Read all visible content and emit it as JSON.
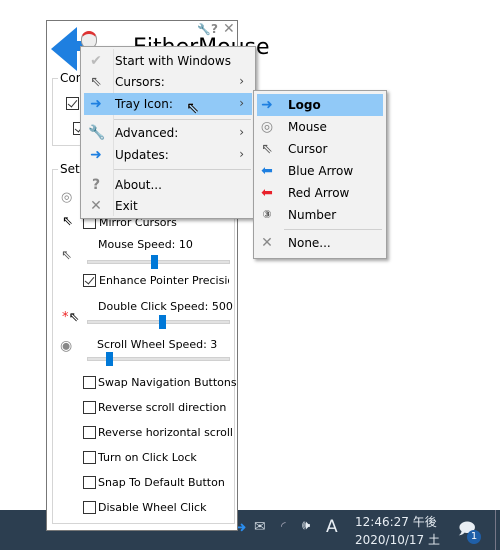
{
  "window": {
    "title": "EitherMouse",
    "controls_label": "Controls",
    "settings_label": "Settings",
    "title_icons": [
      "wrench-icon",
      "help-icon",
      "close-icon"
    ],
    "settings": {
      "mirror_cursors": {
        "label": "Mirror Cursors",
        "checked": false
      },
      "mouse_speed": {
        "label": "Mouse Speed: 10",
        "value": 10
      },
      "enhance_precision": {
        "label": "Enhance Pointer Precision",
        "checked": true
      },
      "double_click": {
        "label": "Double Click Speed: 500",
        "value": 500
      },
      "scroll_speed": {
        "label": "Scroll Wheel Speed: 3",
        "value": 3
      },
      "checkboxes": [
        {
          "label": "Swap Navigation Buttons",
          "checked": false
        },
        {
          "label": "Reverse scroll direction",
          "checked": false
        },
        {
          "label": "Reverse horizontal scroll",
          "checked": false
        },
        {
          "label": "Turn on Click Lock",
          "checked": false
        },
        {
          "label": "Snap To Default Button",
          "checked": false
        },
        {
          "label": "Disable Wheel Click",
          "checked": false
        }
      ]
    }
  },
  "context_menu": {
    "items": [
      {
        "label": "Start with Windows",
        "icon": "check-icon"
      },
      {
        "label": "Cursors:",
        "icon": "cursor-icon",
        "submenu": true
      },
      {
        "label": "Tray Icon:",
        "icon": "tray-logo-icon",
        "submenu": true,
        "highlighted": true
      },
      {
        "label": "Advanced:",
        "icon": "wrench-icon",
        "submenu": true
      },
      {
        "label": "Updates:",
        "icon": "blue-arrow-icon",
        "submenu": true
      },
      {
        "label": "About...",
        "icon": "help-icon"
      },
      {
        "label": "Exit",
        "icon": "close-icon"
      }
    ]
  },
  "tray_submenu": {
    "items": [
      {
        "label": "Logo",
        "icon": "logo-icon",
        "selected": true
      },
      {
        "label": "Mouse",
        "icon": "mouse-icon"
      },
      {
        "label": "Cursor",
        "icon": "cursor-icon"
      },
      {
        "label": "Blue Arrow",
        "icon": "blue-arrow-icon"
      },
      {
        "label": "Red Arrow",
        "icon": "red-arrow-icon"
      },
      {
        "label": "Number",
        "icon": "number-icon"
      },
      {
        "label": "None...",
        "icon": "close-icon"
      }
    ]
  },
  "taskbar": {
    "time": "12:46:27 午後",
    "date": "2020/10/17 土",
    "ime": "A",
    "notification_count": "1"
  },
  "colors": {
    "accent": "#0078d7",
    "highlight": "#91c9f7",
    "taskbar": "#2c3e50"
  }
}
